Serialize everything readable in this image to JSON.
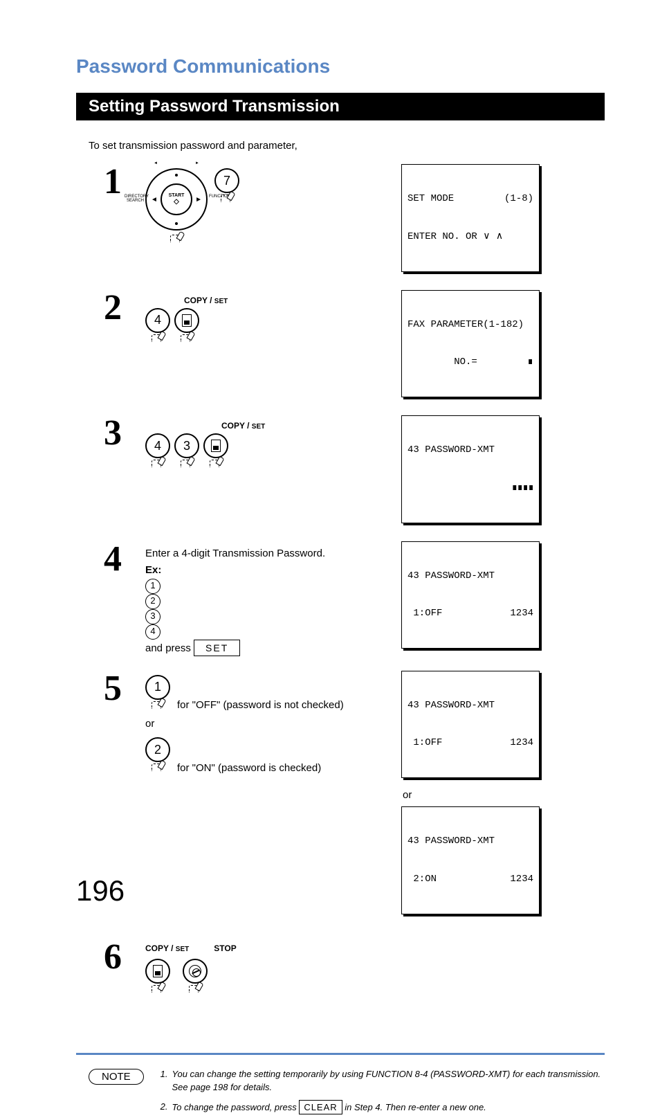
{
  "title": "Password Communications",
  "section_heading": "Setting Password Transmission",
  "intro": "To set transmission password and parameter,",
  "copyset_label_prefix": "COPY / ",
  "copyset_label_suffix": "SET",
  "stop_label": "STOP",
  "steps": {
    "1": {
      "num": "1",
      "dial_center_top": "START",
      "dial_mini_left": "DIRECTORY\nSEARCH",
      "dial_mini_right": "FUNCTION",
      "key": "7",
      "lcd_l1_left": "SET MODE",
      "lcd_l1_right": "(1-8)",
      "lcd_l2": "ENTER NO. OR ∨ ∧"
    },
    "2": {
      "num": "2",
      "key": "4",
      "lcd_l1": "FAX PARAMETER(1-182)",
      "lcd_l2_left": "        NO.=",
      "lcd_l2_cursor": "∎"
    },
    "3": {
      "num": "3",
      "key_a": "4",
      "key_b": "3",
      "lcd_l1": "43 PASSWORD-XMT",
      "lcd_squares": "∎∎∎∎"
    },
    "4": {
      "num": "4",
      "line1": "Enter a 4-digit Transmission Password.",
      "ex_label": "Ex:",
      "digits": [
        "1",
        "2",
        "3",
        "4"
      ],
      "and_press": " and press ",
      "set_btn": "SET",
      "lcd_l1": "43 PASSWORD-XMT",
      "lcd_l2_left": " 1:OFF",
      "lcd_l2_right": "1234"
    },
    "5": {
      "num": "5",
      "key_off": "1",
      "off_text": "for \"OFF\" (password is not checked)",
      "or": "or",
      "key_on": "2",
      "on_text": "for \"ON\" (password is checked)",
      "lcdA_l1": "43 PASSWORD-XMT",
      "lcdA_l2_left": " 1:OFF",
      "lcdA_l2_right": "1234",
      "or_right": "or",
      "lcdB_l1": "43 PASSWORD-XMT",
      "lcdB_l2_left": " 2:ON",
      "lcdB_l2_right": "1234"
    },
    "6": {
      "num": "6"
    }
  },
  "note_label": "NOTE",
  "notes": {
    "1": {
      "n": "1.",
      "text_a": "You can change the setting temporarily by using FUNCTION 8-4 (PASSWORD-XMT) for each transmission. See page 198 for details."
    },
    "2": {
      "n": "2.",
      "text_a": "To change the password, press ",
      "clear": "CLEAR",
      "text_b": " in Step 4. Then re-enter a new one."
    }
  },
  "page_number": "196"
}
